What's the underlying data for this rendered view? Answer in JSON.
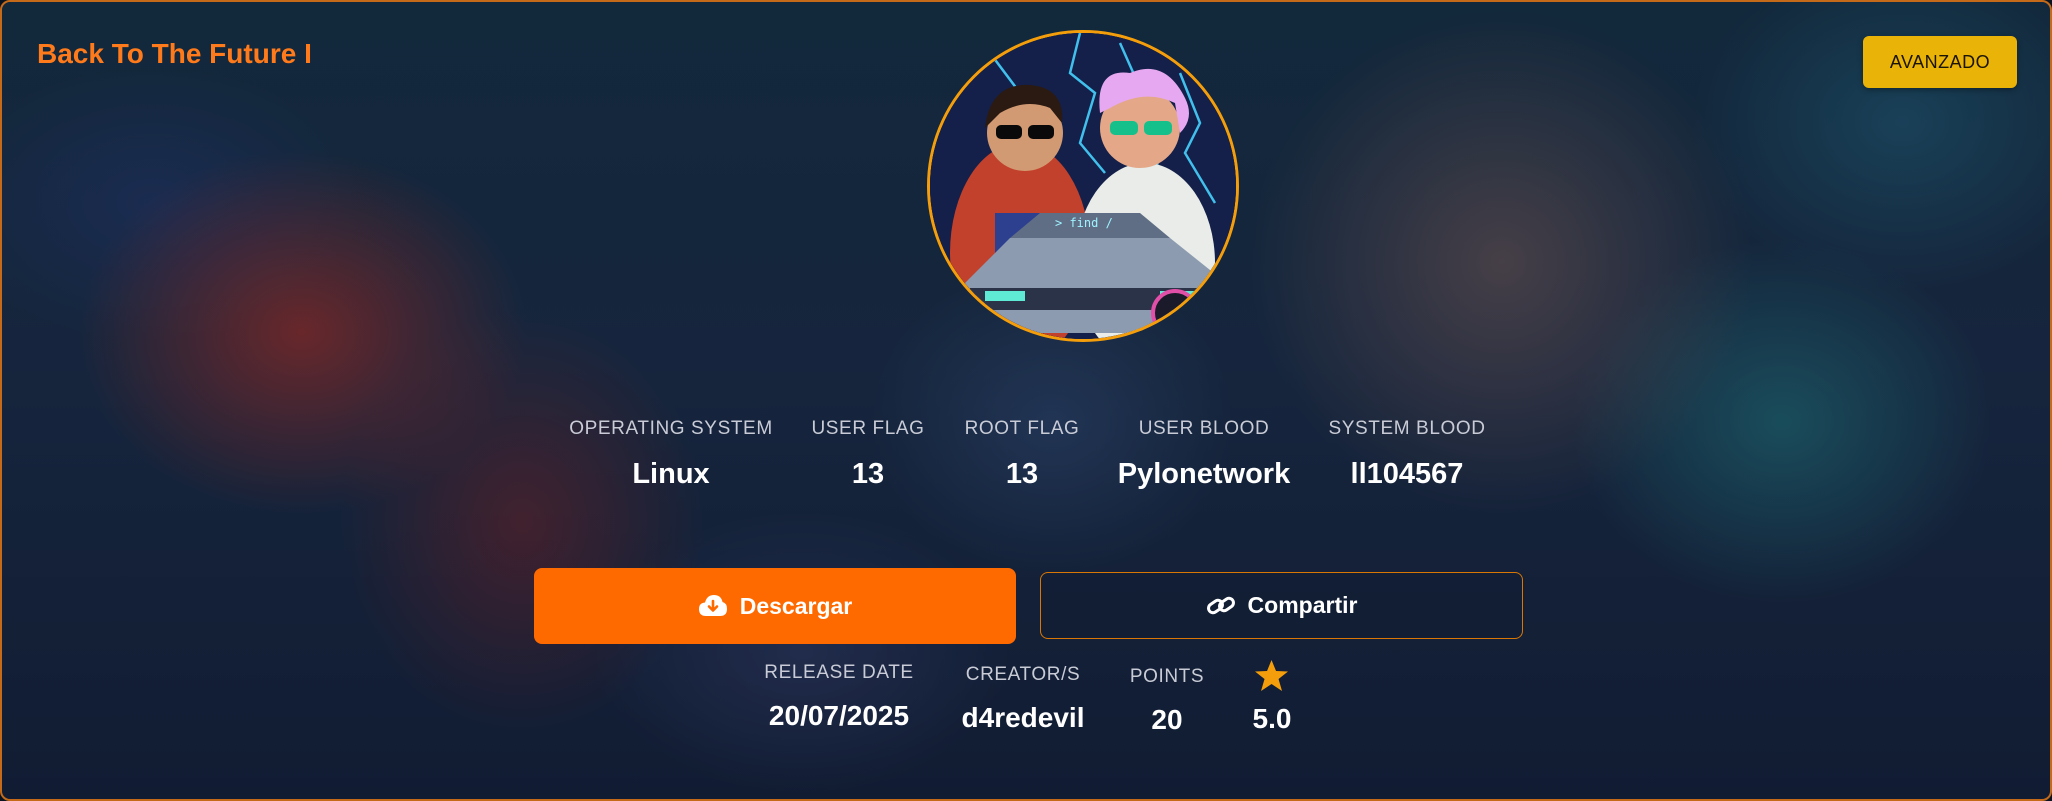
{
  "machine": {
    "title": "Back To The Future I",
    "difficulty": "AVANZADO"
  },
  "avatar": {
    "image_text": "> find /"
  },
  "stats": [
    {
      "label": "OPERATING SYSTEM",
      "value": "Linux"
    },
    {
      "label": "USER FLAG",
      "value": "13"
    },
    {
      "label": "ROOT FLAG",
      "value": "13"
    },
    {
      "label": "USER BLOOD",
      "value": "Pylonetwork"
    },
    {
      "label": "SYSTEM BLOOD",
      "value": "ll104567"
    }
  ],
  "actions": {
    "download_label": "Descargar",
    "share_label": "Compartir"
  },
  "details": [
    {
      "label": "RELEASE DATE",
      "value": "20/07/2025"
    },
    {
      "label": "CREATOR/S",
      "value": "d4redevil"
    },
    {
      "label": "POINTS",
      "value": "20"
    }
  ],
  "rating": {
    "icon": "star-icon",
    "value": "5.0"
  },
  "colors": {
    "accent": "#ff6a00",
    "title": "#ff7a1a",
    "badge": "#eab308",
    "star": "#f59e0b",
    "border": "#c46a18"
  }
}
